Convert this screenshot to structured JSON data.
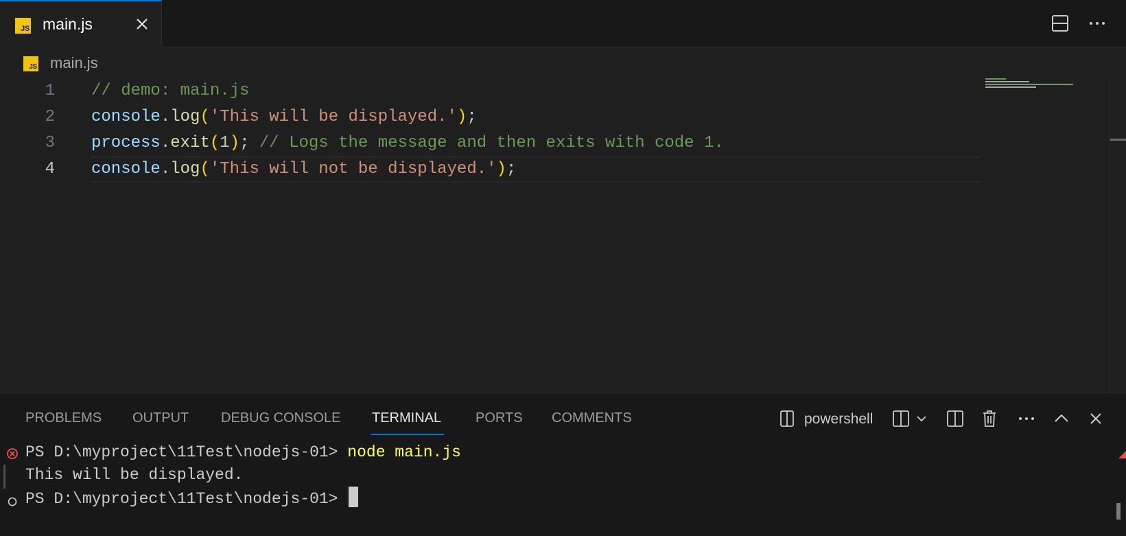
{
  "tabs": [
    {
      "label": "main.js",
      "icon": "JS",
      "active": true
    }
  ],
  "breadcrumb": {
    "icon": "JS",
    "label": "main.js"
  },
  "editor": {
    "lines": [
      {
        "number": "1",
        "tokens": [
          {
            "t": "// demo: main.js",
            "k": "comment"
          }
        ]
      },
      {
        "number": "2",
        "tokens": [
          {
            "t": "console",
            "k": "var"
          },
          {
            "t": ".",
            "k": "punc"
          },
          {
            "t": "log",
            "k": "fn"
          },
          {
            "t": "(",
            "k": "paren"
          },
          {
            "t": "'This will be displayed.'",
            "k": "str"
          },
          {
            "t": ")",
            "k": "paren"
          },
          {
            "t": ";",
            "k": "punc"
          }
        ]
      },
      {
        "number": "3",
        "tokens": [
          {
            "t": "process",
            "k": "var"
          },
          {
            "t": ".",
            "k": "punc"
          },
          {
            "t": "exit",
            "k": "fn"
          },
          {
            "t": "(",
            "k": "paren"
          },
          {
            "t": "1",
            "k": "num"
          },
          {
            "t": ")",
            "k": "paren"
          },
          {
            "t": "; ",
            "k": "punc"
          },
          {
            "t": "// Logs the message and then exits with code 1.",
            "k": "comment"
          }
        ]
      },
      {
        "number": "4",
        "current": true,
        "tokens": [
          {
            "t": "console",
            "k": "var"
          },
          {
            "t": ".",
            "k": "punc"
          },
          {
            "t": "log",
            "k": "fn"
          },
          {
            "t": "(",
            "k": "paren"
          },
          {
            "t": "'This will not be displayed.'",
            "k": "str"
          },
          {
            "t": ")",
            "k": "paren"
          },
          {
            "t": ";",
            "k": "punc"
          }
        ]
      }
    ]
  },
  "panel": {
    "tabs": [
      {
        "label": "PROBLEMS"
      },
      {
        "label": "OUTPUT"
      },
      {
        "label": "DEBUG CONSOLE"
      },
      {
        "label": "TERMINAL",
        "active": true
      },
      {
        "label": "PORTS"
      },
      {
        "label": "COMMENTS"
      }
    ],
    "terminal_name": "powershell",
    "terminal": {
      "line1_prompt": "PS D:\\myproject\\11Test\\nodejs-01> ",
      "line1_command": "node main.js",
      "line2_output": "This will be displayed.",
      "line3_prompt": "PS D:\\myproject\\11Test\\nodejs-01> "
    }
  },
  "colors": {
    "accent": "#0078d4",
    "js_badge": "#f1c40f",
    "error": "#f14c4c",
    "comment": "#6a9955",
    "string": "#ce9178"
  }
}
